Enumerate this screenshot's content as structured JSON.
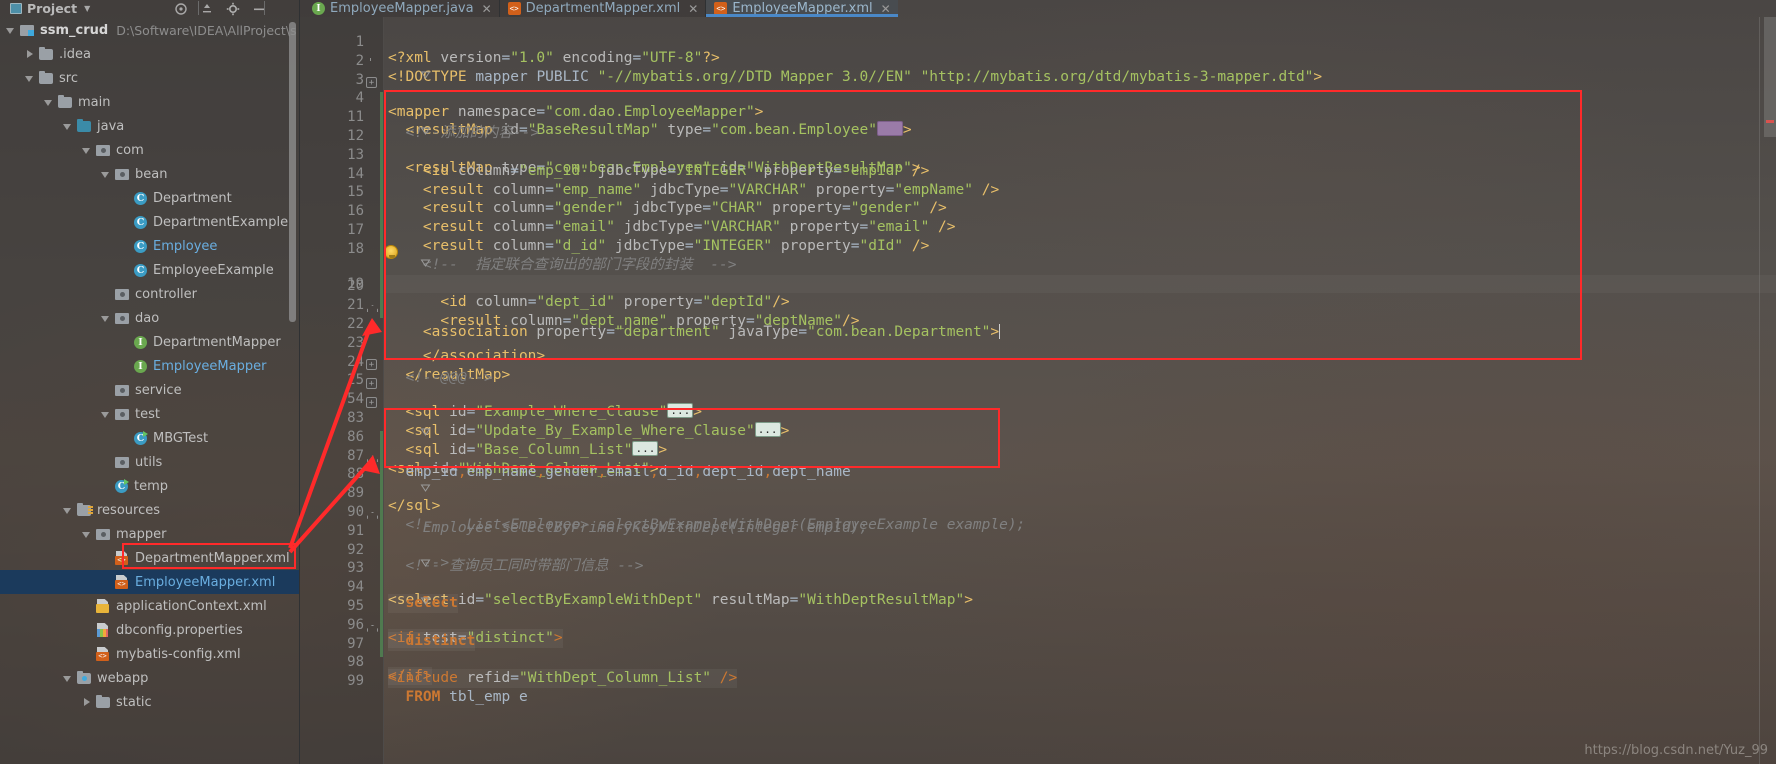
{
  "project_pane": {
    "title": "Project",
    "toolbar_icons": [
      "target-icon",
      "collapse-all-icon",
      "gear-icon",
      "minimize-icon"
    ],
    "root": {
      "name": "ssm_crud",
      "path": "D:\\Software\\IDEA\\AllProject\\s"
    },
    "items": [
      {
        "label": ".idea",
        "icon": "folder-icon",
        "arrow": "closed",
        "indent": 2
      },
      {
        "label": "src",
        "icon": "folder-icon",
        "arrow": "open",
        "indent": 2
      },
      {
        "label": "main",
        "icon": "folder-icon",
        "arrow": "open",
        "indent": 3
      },
      {
        "label": "java",
        "icon": "folder-java-icon",
        "arrow": "open",
        "indent": 4
      },
      {
        "label": "com",
        "icon": "folder-package-icon",
        "arrow": "open",
        "indent": 5
      },
      {
        "label": "bean",
        "icon": "folder-package-icon",
        "arrow": "open",
        "indent": 6
      },
      {
        "label": "Department",
        "icon": "class-icon",
        "arrow": "none",
        "indent": 7
      },
      {
        "label": "DepartmentExample",
        "icon": "class-icon",
        "arrow": "none",
        "indent": 7
      },
      {
        "label": "Employee",
        "icon": "class-icon",
        "arrow": "none",
        "indent": 7,
        "highlighted": true
      },
      {
        "label": "EmployeeExample",
        "icon": "class-icon",
        "arrow": "none",
        "indent": 7
      },
      {
        "label": "controller",
        "icon": "folder-package-icon",
        "arrow": "none",
        "indent": 6
      },
      {
        "label": "dao",
        "icon": "folder-package-icon",
        "arrow": "open",
        "indent": 6
      },
      {
        "label": "DepartmentMapper",
        "icon": "interface-icon",
        "arrow": "none",
        "indent": 7
      },
      {
        "label": "EmployeeMapper",
        "icon": "interface-icon",
        "arrow": "none",
        "indent": 7,
        "highlighted": true
      },
      {
        "label": "service",
        "icon": "folder-package-icon",
        "arrow": "none",
        "indent": 6
      },
      {
        "label": "test",
        "icon": "folder-package-icon",
        "arrow": "open",
        "indent": 6
      },
      {
        "label": "MBGTest",
        "icon": "class-runnable-icon",
        "arrow": "none",
        "indent": 7
      },
      {
        "label": "utils",
        "icon": "folder-package-icon",
        "arrow": "none",
        "indent": 6
      },
      {
        "label": "temp",
        "icon": "class-runnable-icon",
        "arrow": "none",
        "indent": 6
      },
      {
        "label": "resources",
        "icon": "folder-resources-icon",
        "arrow": "open",
        "indent": 4
      },
      {
        "label": "mapper",
        "icon": "folder-package-icon",
        "arrow": "open",
        "indent": 5
      },
      {
        "label": "DepartmentMapper.xml",
        "icon": "xml-file-icon",
        "arrow": "none",
        "indent": 6
      },
      {
        "label": "EmployeeMapper.xml",
        "icon": "xml-file-icon",
        "arrow": "none",
        "indent": 6,
        "highlighted": true,
        "selected": true
      },
      {
        "label": "applicationContext.xml",
        "icon": "spring-xml-file-icon",
        "arrow": "none",
        "indent": 5
      },
      {
        "label": "dbconfig.properties",
        "icon": "properties-file-icon",
        "arrow": "none",
        "indent": 5
      },
      {
        "label": "mybatis-config.xml",
        "icon": "xml-file-icon",
        "arrow": "none",
        "indent": 5
      },
      {
        "label": "webapp",
        "icon": "folder-web-icon",
        "arrow": "open",
        "indent": 4
      },
      {
        "label": "static",
        "icon": "folder-icon",
        "arrow": "closed",
        "indent": 5
      }
    ]
  },
  "tabs": [
    {
      "label": "EmployeeMapper.java",
      "icon": "interface-icon",
      "icon_glyph": "I",
      "active": false
    },
    {
      "label": "DepartmentMapper.xml",
      "icon": "xml-file-icon",
      "icon_glyph": "<>",
      "active": false
    },
    {
      "label": "EmployeeMapper.xml",
      "icon": "xml-file-icon",
      "icon_glyph": "<>",
      "active": true
    }
  ],
  "editor": {
    "file": "EmployeeMapper.xml",
    "lines": [
      {
        "num": "1",
        "fold": "",
        "text": "<?xml version=\"1.0\" encoding=\"UTF-8\"?>"
      },
      {
        "num": "2",
        "fold": "",
        "text": "<!DOCTYPE mapper PUBLIC \"-//mybatis.org//DTD Mapper 3.0//EN\" \"http://mybatis.org/dtd/mybatis-3-mapper.dtd\">"
      },
      {
        "num": "3",
        "fold": "top",
        "text": "<mapper namespace=\"com.dao.EmployeeMapper\">"
      },
      {
        "num": "4",
        "fold": "plus",
        "text": "  <resultMap id=\"BaseResultMap\" type=\"com.bean.Employee\"...>"
      },
      {
        "num": "11",
        "fold": "",
        "text": "  <!--添加的内容-->"
      },
      {
        "num": "12",
        "fold": "minus",
        "text": "  <resultMap type=\"com.bean.Employee\" id=\"WithDeptResultMap\">"
      },
      {
        "num": "13",
        "fold": "",
        "text": "    <id column=\"emp_id\" jdbcType=\"INTEGER\" property=\"empId\" />"
      },
      {
        "num": "14",
        "fold": "",
        "text": "    <result column=\"emp_name\" jdbcType=\"VARCHAR\" property=\"empName\" />"
      },
      {
        "num": "15",
        "fold": "",
        "text": "    <result column=\"gender\" jdbcType=\"CHAR\" property=\"gender\" />"
      },
      {
        "num": "16",
        "fold": "",
        "text": "    <result column=\"email\" jdbcType=\"VARCHAR\" property=\"email\" />"
      },
      {
        "num": "17",
        "fold": "",
        "text": "    <result column=\"d_id\" jdbcType=\"INTEGER\" property=\"dId\" />"
      },
      {
        "num": "18",
        "fold": "",
        "text": "    <!--  指定联合查询出的部门字段的封装  -->"
      },
      {
        "num": "19",
        "fold": "minus",
        "text": "    <association property=\"department\" javaType=\"com.bean.Department\">"
      },
      {
        "num": "20",
        "fold": "",
        "text": "      <id column=\"dept_id\" property=\"deptId\"/>"
      },
      {
        "num": "21",
        "fold": "",
        "text": "      <result column=\"dept_name\" property=\"deptName\"/>"
      },
      {
        "num": "22",
        "fold": "arrowup",
        "text": "    </association>"
      },
      {
        "num": "23",
        "fold": "arrowup",
        "text": "  </resultMap>"
      },
      {
        "num": "24",
        "fold": "",
        "text": "  <!--@@@-->"
      },
      {
        "num": "25",
        "fold": "plus",
        "text": "  <sql id=\"Example_Where_Clause\"...>"
      },
      {
        "num": "54",
        "fold": "plus",
        "text": "  <sql id=\"Update_By_Example_Where_Clause\"...>"
      },
      {
        "num": "83",
        "fold": "plus",
        "text": "  <sql id=\"Base_Column_List\"...>"
      },
      {
        "num": "86",
        "fold": "minus",
        "text": "  <sql id=\"WithDept_Column_List\">"
      },
      {
        "num": "87",
        "fold": "",
        "text": "    emp_id,emp_name,gender,email,d_id,dept_id,dept_name"
      },
      {
        "num": "88",
        "fold": "arrowup",
        "text": "  </sql>"
      },
      {
        "num": "89",
        "fold": "minus",
        "text": "  <!--   List<Employee> selectByExampleWithDept(EmployeeExample example);"
      },
      {
        "num": "90",
        "fold": "",
        "text": "    Employee selectByPrimaryKeyWithDept(Integer empId);"
      },
      {
        "num": "91",
        "fold": "arrowup",
        "text": "    -->"
      },
      {
        "num": "92",
        "fold": "",
        "text": "  <!-- 查询员工同时带部门信息 -->"
      },
      {
        "num": "93",
        "fold": "minus",
        "text": "  <select id=\"selectByExampleWithDept\" resultMap=\"WithDeptResultMap\">"
      },
      {
        "num": "94",
        "fold": "",
        "text": "    select"
      },
      {
        "num": "95",
        "fold": "minus",
        "text": "    <if test=\"distinct\">"
      },
      {
        "num": "96",
        "fold": "",
        "text": "      distinct"
      },
      {
        "num": "97",
        "fold": "arrowup",
        "text": "    </if>"
      },
      {
        "num": "98",
        "fold": "",
        "text": "    <include refid=\"WithDept_Column_List\" />"
      },
      {
        "num": "99",
        "fold": "",
        "text": "    FROM tbl_emp e"
      }
    ]
  },
  "annotations": {
    "boxes": [
      "resultMap-block-highlight",
      "withdept-column-list-highlight",
      "employeemapper-xml-file-highlight"
    ],
    "arrow_color": "#ff2a2a"
  },
  "watermark": "https://blog.csdn.net/Yuz_99"
}
